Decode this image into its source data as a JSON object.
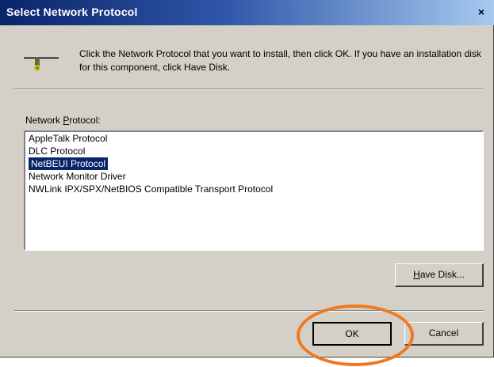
{
  "window": {
    "title": "Select Network Protocol",
    "close_glyph": "×"
  },
  "instructions": {
    "text": "Click the Network Protocol that you want to install, then click OK. If you have an installation disk for this component, click Have Disk.",
    "icon": "network-protocol-icon"
  },
  "protocol_list": {
    "label_prefix": "Network ",
    "label_underlined": "P",
    "label_suffix": "rotocol:",
    "items": [
      {
        "label": "AppleTalk Protocol",
        "selected": false
      },
      {
        "label": "DLC Protocol",
        "selected": false
      },
      {
        "label": "NetBEUI Protocol",
        "selected": true
      },
      {
        "label": "Network Monitor Driver",
        "selected": false
      },
      {
        "label": "NWLink IPX/SPX/NetBIOS Compatible Transport Protocol",
        "selected": false
      }
    ]
  },
  "buttons": {
    "have_disk_underlined": "H",
    "have_disk_rest": "ave Disk...",
    "ok": "OK",
    "cancel": "Cancel"
  },
  "colors": {
    "title_bar": "#0a246a",
    "selection": "#0a246a",
    "dialog_face": "#d4d0c8",
    "annotation_ring": "#f07820"
  }
}
